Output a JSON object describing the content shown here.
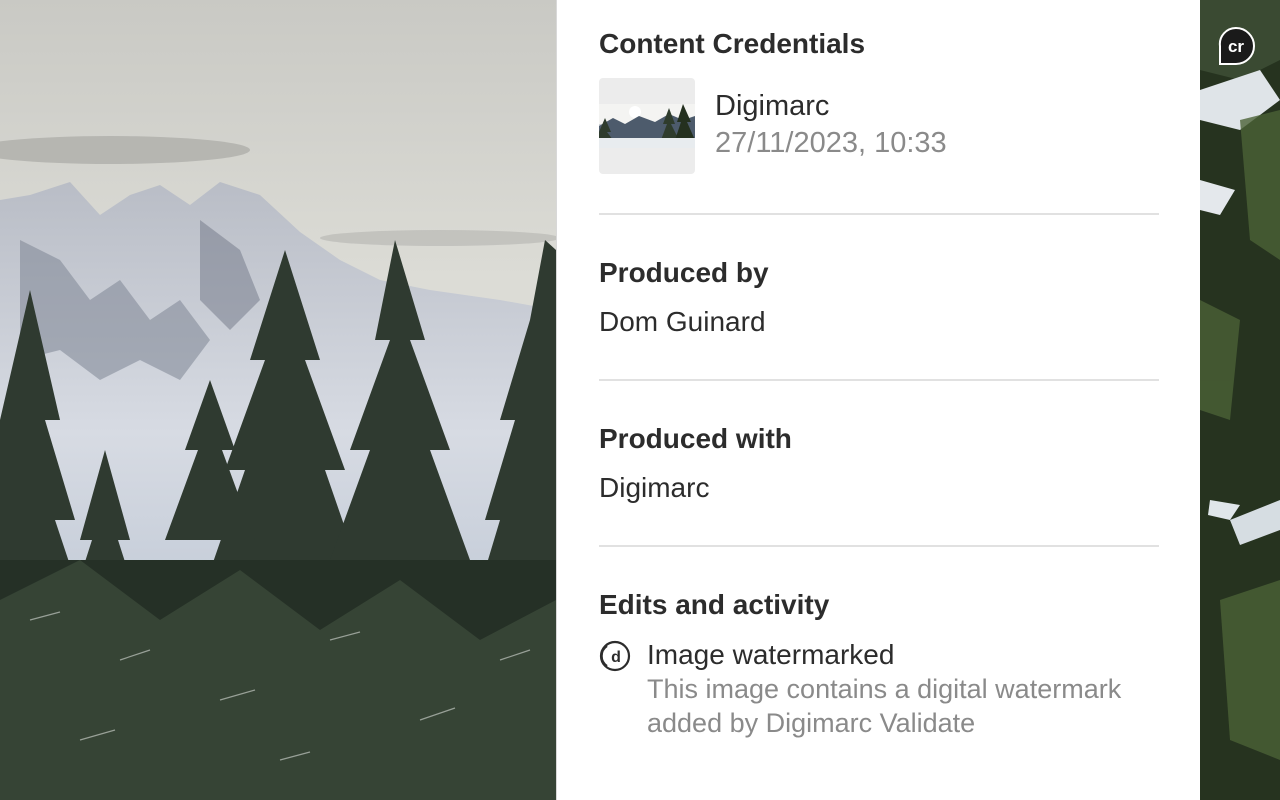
{
  "credentials": {
    "title": "Content Credentials",
    "issuer": "Digimarc",
    "date": "27/11/2023, 10:33",
    "thumbnail_icon": "landscape-thumbnail"
  },
  "produced_by": {
    "title": "Produced by",
    "value": "Dom Guinard"
  },
  "produced_with": {
    "title": "Produced with",
    "value": "Digimarc"
  },
  "edits": {
    "title": "Edits and activity",
    "items": [
      {
        "icon": "digimarc-watermark-icon",
        "title": "Image watermarked",
        "description": "This image contains a digital watermark added by Digimarc Validate"
      }
    ]
  },
  "badge": {
    "icon": "content-credentials-cr-icon",
    "label": "cr"
  },
  "colors": {
    "text_primary": "#2c2c2c",
    "text_secondary": "#8a8a8a",
    "divider": "#e1e1e1",
    "panel_bg": "#ffffff"
  }
}
